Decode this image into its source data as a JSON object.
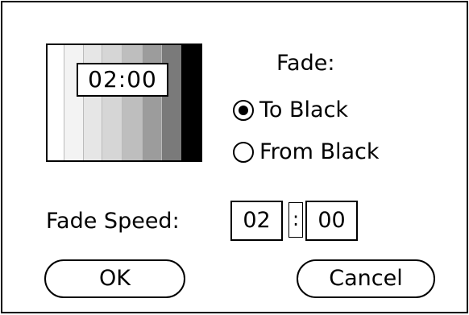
{
  "dialog": {
    "preview": {
      "time": "02:00",
      "strip_colors": [
        "#ffffff",
        "#f3f3f3",
        "#e6e6e6",
        "#d6d6d6",
        "#bebebe",
        "#9c9c9c",
        "#7a7a7a",
        "#525252",
        "#000000"
      ]
    },
    "fade": {
      "title": "Fade:",
      "options": [
        {
          "label": "To Black",
          "selected": true
        },
        {
          "label": "From Black",
          "selected": false
        }
      ]
    },
    "speed": {
      "label": "Fade Speed:",
      "minutes": "02",
      "separator": ":",
      "seconds": "00"
    },
    "buttons": {
      "ok": "OK",
      "cancel": "Cancel"
    }
  }
}
